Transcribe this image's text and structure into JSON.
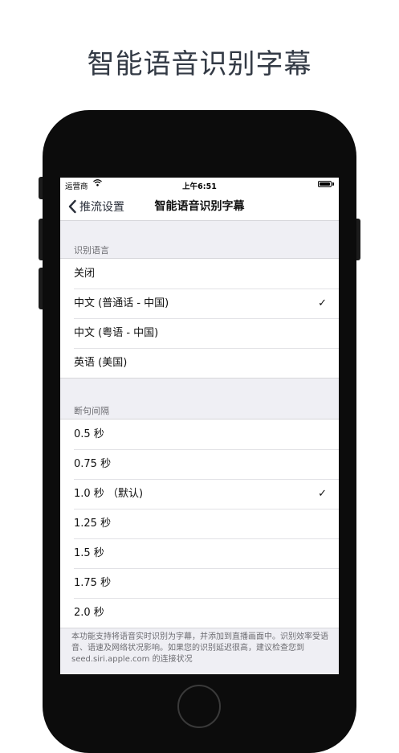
{
  "headline": "智能语音识别字幕",
  "status_bar": {
    "carrier": "运营商",
    "time": "上午6:51"
  },
  "nav": {
    "back_label": "推流设置",
    "title": "智能语音识别字幕"
  },
  "language_section": {
    "header": "识别语言",
    "options": [
      {
        "label": "关闭",
        "selected": false
      },
      {
        "label": "中文 (普通话 - 中国)",
        "selected": true
      },
      {
        "label": "中文 (粤语 - 中国)",
        "selected": false
      },
      {
        "label": "英语 (美国)",
        "selected": false
      }
    ]
  },
  "interval_section": {
    "header": "断句间隔",
    "options": [
      {
        "label": "0.5 秒",
        "selected": false
      },
      {
        "label": "0.75 秒",
        "selected": false
      },
      {
        "label": "1.0 秒 （默认)",
        "selected": true
      },
      {
        "label": "1.25 秒",
        "selected": false
      },
      {
        "label": "1.5 秒",
        "selected": false
      },
      {
        "label": "1.75 秒",
        "selected": false
      },
      {
        "label": "2.0 秒",
        "selected": false
      }
    ]
  },
  "check_mark": "✓",
  "footer_note": "本功能支持将语音实时识别为字幕，并添加到直播画面中。识别效率受语音、语速及网络状况影响。如果您的识别延迟很高，建议检查您到 seed.siri.apple.com 的连接状况",
  "colors": {
    "page_bg": "#ffffff",
    "headline": "#333a45",
    "device_body": "#0c0c0c",
    "grouped_bg": "#efeff4",
    "secondary_text": "#6d6d72"
  }
}
